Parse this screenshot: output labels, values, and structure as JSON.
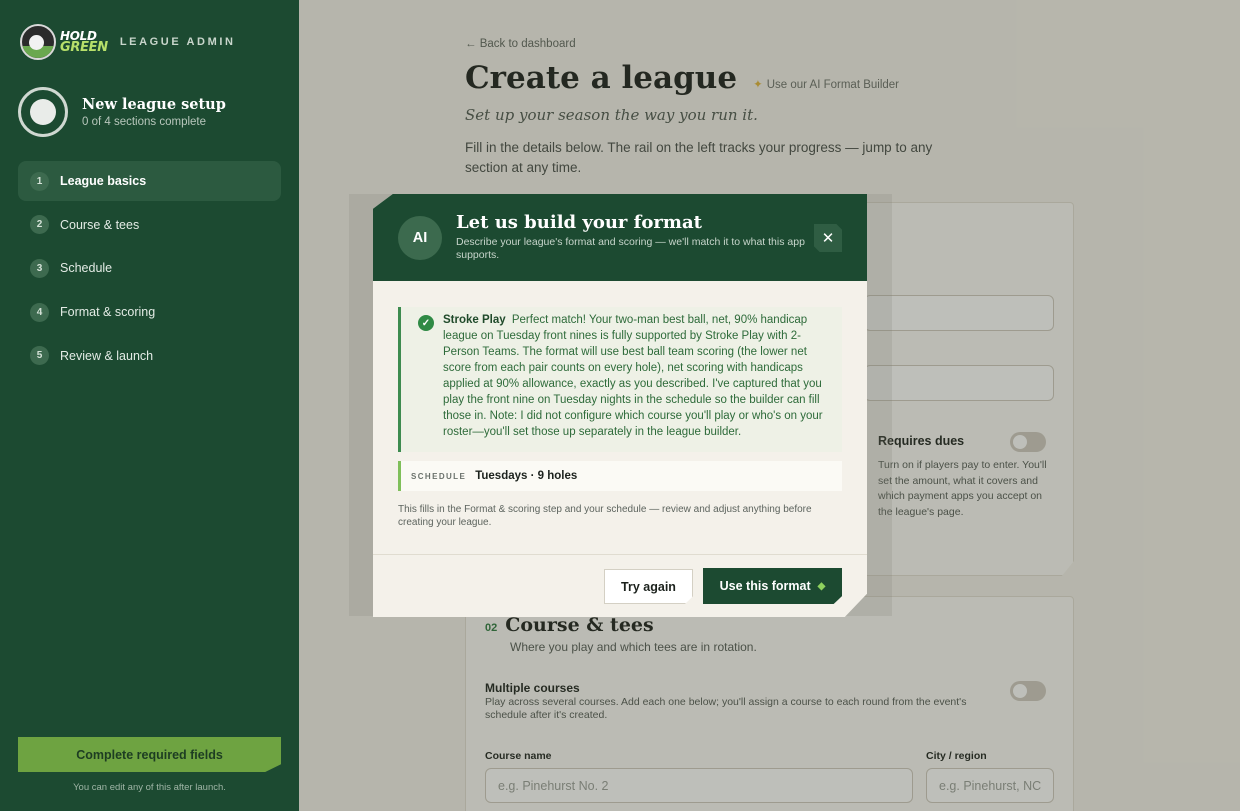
{
  "sidebar": {
    "logo_line1": "HOLD",
    "logo_line2": "GREEN",
    "brand_sub": "LEAGUE ADMIN",
    "setup_title": "New league setup",
    "setup_progress": "0 of 4 sections complete",
    "steps": [
      {
        "num": "1",
        "label": "League basics",
        "active": true
      },
      {
        "num": "2",
        "label": "Course & tees"
      },
      {
        "num": "3",
        "label": "Schedule"
      },
      {
        "num": "4",
        "label": "Format & scoring"
      },
      {
        "num": "5",
        "label": "Review & launch"
      }
    ],
    "complete_button": "Complete required fields",
    "edit_note": "You can edit any of this after launch."
  },
  "main": {
    "back_link": "← Back to dashboard",
    "title": "Create a league",
    "ai_link": "Use our AI Format Builder",
    "subtitle": "Set up your season the way you run it.",
    "intro": "Fill in the details below. The rail on the left tracks your progress — jump to any section at any time.",
    "dues": {
      "title": "Requires dues",
      "enabled": false,
      "description": "Turn on if players pay to enter. You'll set the amount, what it covers and which payment apps you accept on the league's page."
    },
    "course_section": {
      "number": "02",
      "title": "Course & tees",
      "subtitle": "Where you play and which tees are in rotation.",
      "multiple_title": "Multiple courses",
      "multiple_enabled": false,
      "multiple_desc": "Play across several courses. Add each one below; you'll assign a course to each round from the event's schedule after it's created.",
      "course_name_label": "Course name",
      "course_name_placeholder": "e.g. Pinehurst No. 2",
      "city_label": "City / region",
      "city_placeholder": "e.g. Pinehurst, NC"
    }
  },
  "modal": {
    "badge": "AI",
    "title": "Let us build your format",
    "description": "Describe your league's format and scoring — we'll match it to what this app supports.",
    "close_icon": "✕",
    "result_format": "Stroke Play",
    "result_text": "Perfect match! Your two-man best ball, net, 90% handicap league on Tuesday front nines is fully supported by Stroke Play with 2-Person Teams. The format will use best ball team scoring (the lower net score from each pair counts on every hole), net scoring with handicaps applied at 90% allowance, exactly as you described. I've captured that you play the front nine on Tuesday nights in the schedule so the builder can fill those in. Note: I did not configure which course you'll play or who's on your roster—you'll set those up separately in the league builder.",
    "schedule_label": "SCHEDULE",
    "schedule_value": "Tuesdays · 9 holes",
    "fills_note": "This fills in the Format & scoring step and your schedule — review and adjust anything before creating your league.",
    "try_again": "Try again",
    "use_format": "Use this format"
  },
  "colors": {
    "sidebar_bg": "#1c4a31",
    "accent_green": "#6ea341",
    "success_green": "#2f8a45"
  }
}
